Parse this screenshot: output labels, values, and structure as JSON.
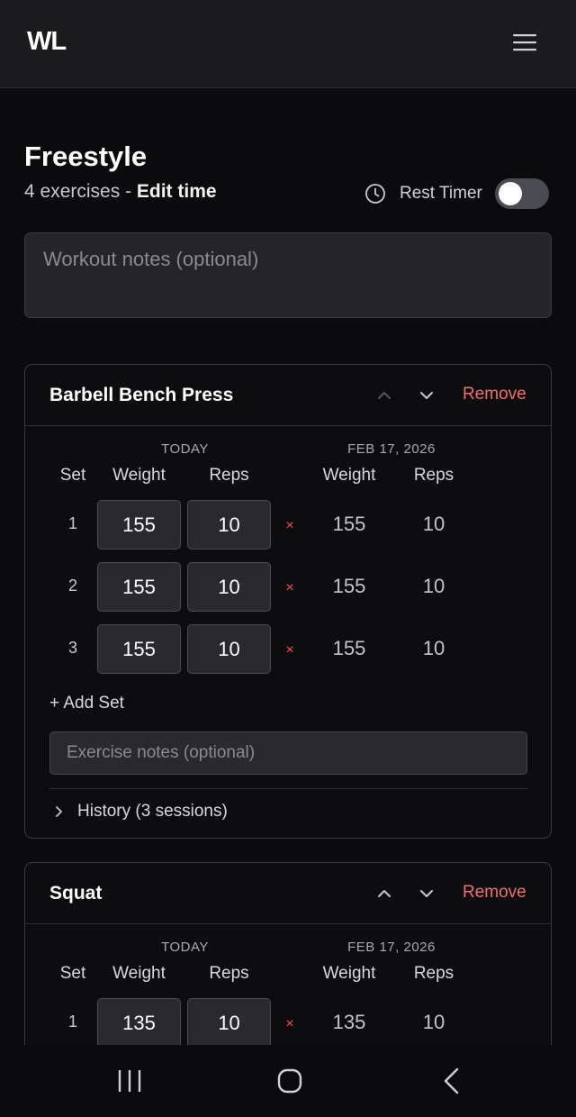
{
  "app": {
    "logo": "WL"
  },
  "workout": {
    "title": "Freestyle",
    "exercise_count": "4 exercises",
    "separator": " - ",
    "edit_time": "Edit time",
    "rest_timer_label": "Rest Timer",
    "rest_timer_on": false,
    "notes_placeholder": "Workout notes (optional)",
    "notes_value": ""
  },
  "exercises": [
    {
      "name": "Barbell Bench Press",
      "remove_label": "Remove",
      "today_label": "TODAY",
      "prev_date_label": "FEB 17, 2026",
      "headers": {
        "set": "Set",
        "weight": "Weight",
        "reps": "Reps",
        "prev_weight": "Weight",
        "prev_reps": "Reps"
      },
      "sets": [
        {
          "set": "1",
          "weight": "155",
          "reps": "10",
          "delete": "×",
          "prev_weight": "155",
          "prev_reps": "10"
        },
        {
          "set": "2",
          "weight": "155",
          "reps": "10",
          "delete": "×",
          "prev_weight": "155",
          "prev_reps": "10"
        },
        {
          "set": "3",
          "weight": "155",
          "reps": "10",
          "delete": "×",
          "prev_weight": "155",
          "prev_reps": "10"
        }
      ],
      "add_set_label": "+ Add Set",
      "notes_placeholder": "Exercise notes (optional)",
      "history_label": "History (3 sessions)"
    },
    {
      "name": "Squat",
      "remove_label": "Remove",
      "today_label": "TODAY",
      "prev_date_label": "FEB 17, 2026",
      "headers": {
        "set": "Set",
        "weight": "Weight",
        "reps": "Reps",
        "prev_weight": "Weight",
        "prev_reps": "Reps"
      },
      "sets": [
        {
          "set": "1",
          "weight": "135",
          "reps": "10",
          "delete": "×",
          "prev_weight": "135",
          "prev_reps": "10"
        }
      ]
    }
  ],
  "colors": {
    "accent_remove": "#ef6f6f",
    "delete_x": "#ef4f4f",
    "background": "#0b0b0d",
    "topbar": "#1b1b1d",
    "input_bg": "#2a2a2e"
  },
  "icons": {
    "menu": "hamburger-menu-icon",
    "clock": "clock-icon",
    "up": "chevron-up-icon",
    "down": "chevron-down-icon",
    "history": "chevron-right-icon",
    "nav_recent": "recent-apps-icon",
    "nav_home": "home-icon",
    "nav_back": "back-icon"
  }
}
